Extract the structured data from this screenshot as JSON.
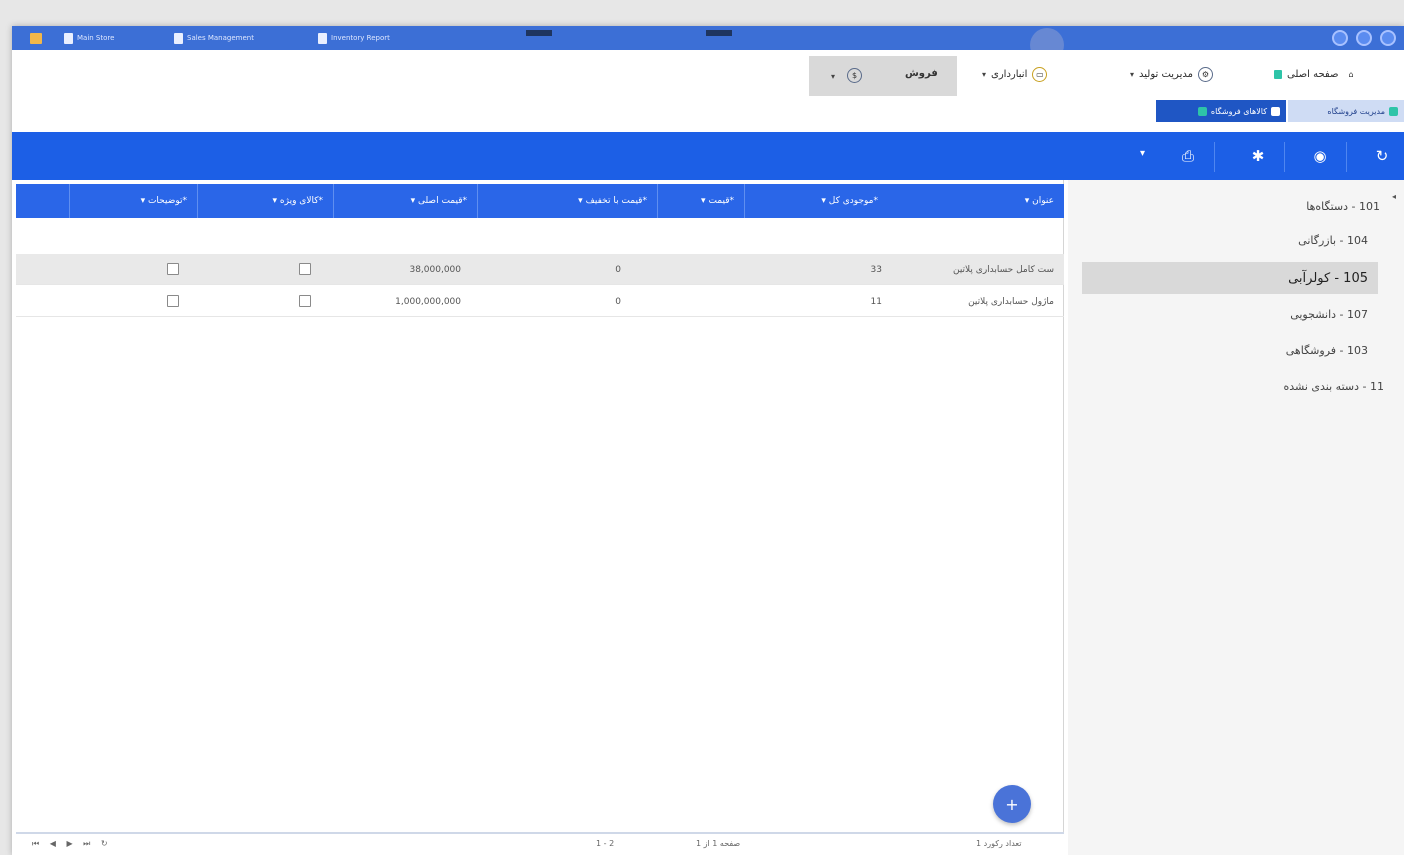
{
  "taskbar": {
    "items": [
      "Main Store",
      "Sales Management",
      "Inventory Report"
    ]
  },
  "menu": {
    "home": "صفحه اصلی",
    "production": "مدیریت تولید",
    "warehouse": "انبارداری",
    "sales": "فروش"
  },
  "tabs": {
    "store_management": "مدیریت فروشگاه",
    "store_products": "کالاهای فروشگاه"
  },
  "tree": {
    "items": [
      {
        "code": "101",
        "label": "دستگاه‌ها"
      },
      {
        "code": "104",
        "label": "بازرگانی"
      },
      {
        "code": "105",
        "label": "کولرآبی"
      },
      {
        "code": "107",
        "label": "دانشجویی"
      },
      {
        "code": "103",
        "label": "فروشگاهی"
      },
      {
        "code": "11",
        "label": "دسته بندی نشده"
      }
    ]
  },
  "grid": {
    "columns": [
      "عنوان",
      "موجودی کل",
      "قیمت",
      "قیمت با تخفیف",
      "قیمت اصلی",
      "کالای ویژه",
      "توضیحات"
    ],
    "rows": [
      {
        "title": "ست کامل حسابداری پلاتین",
        "stock": "33",
        "price": "",
        "discount_price": "0",
        "original_price": "38,000,000",
        "special": false,
        "notes": false
      },
      {
        "title": "ماژول حسابداری پلاتین",
        "stock": "11",
        "price": "",
        "discount_price": "0",
        "original_price": "1,000,000,000",
        "special": false,
        "notes": false
      }
    ]
  },
  "pager": {
    "page_info": "صفحه 1 از 1",
    "range": "1 - 2",
    "size": "تعداد رکورد 1"
  }
}
